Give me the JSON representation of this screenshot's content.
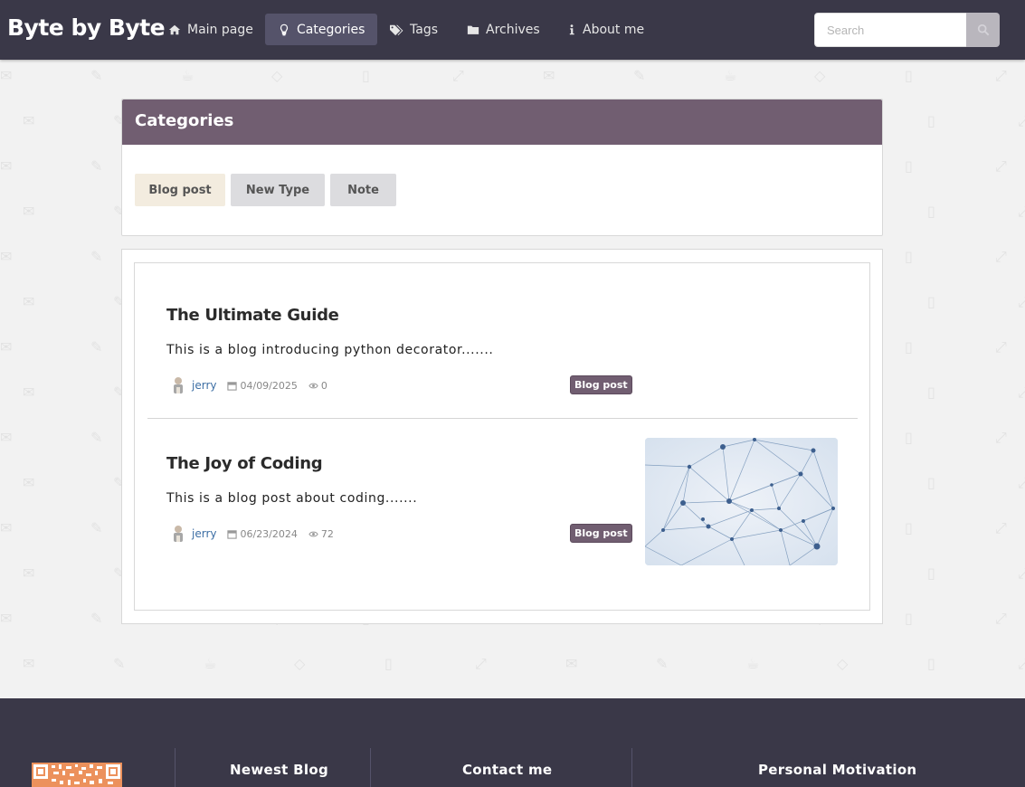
{
  "navbar": {
    "brand": "Byte by Byte",
    "items": [
      {
        "label": "Main page",
        "icon": "home-icon"
      },
      {
        "label": "Categories",
        "icon": "lightbulb-icon",
        "active": true
      },
      {
        "label": "Tags",
        "icon": "tags-icon"
      },
      {
        "label": "Archives",
        "icon": "folder-icon"
      },
      {
        "label": "About me",
        "icon": "info-icon"
      }
    ],
    "search_placeholder": "Search"
  },
  "categories": {
    "title": "Categories",
    "items": [
      {
        "label": "Blog post",
        "selected": true
      },
      {
        "label": "New Type"
      },
      {
        "label": "Note"
      }
    ]
  },
  "posts": [
    {
      "title": "The Ultimate Guide",
      "description": "This is a blog introducing python decorator.......",
      "author": "jerry",
      "date": "04/09/2025",
      "views": "0",
      "tag": "Blog post"
    },
    {
      "title": "The Joy of Coding",
      "description": "This is a blog post about coding.......",
      "author": "jerry",
      "date": "06/23/2024",
      "views": "72",
      "tag": "Blog post"
    }
  ],
  "footer": {
    "columns": [
      "Newest Blog",
      "Contact me",
      "Personal Motivation"
    ]
  },
  "colors": {
    "navbar": "#3a3848",
    "accent": "#715e71",
    "link": "#3c6ea4"
  }
}
